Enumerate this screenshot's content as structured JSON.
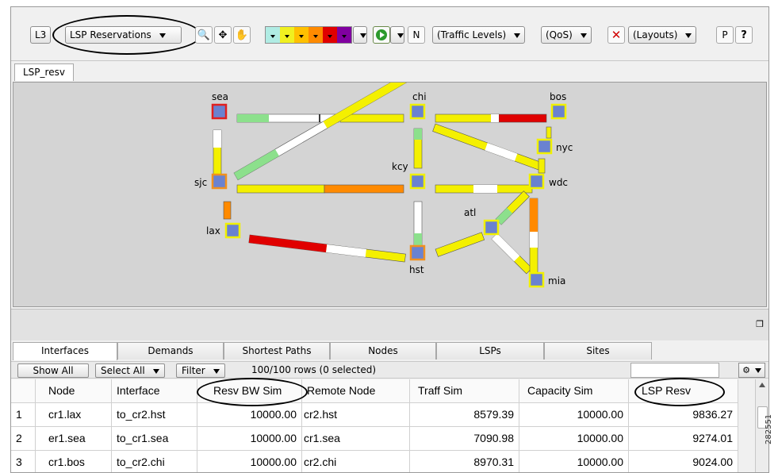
{
  "toolbar": {
    "layer_button": "L3",
    "view_dropdown": "LSP Reservations",
    "traffic_levels": "(Traffic Levels)",
    "qos": "(QoS)",
    "layouts": "(Layouts)",
    "sim_label": "N",
    "help_label": "?",
    "legend_colors": [
      "#b0ece4",
      "#f0f020",
      "#ffc000",
      "#ff8a00",
      "#e00000",
      "#8000a0"
    ]
  },
  "view_tab": "LSP_resv",
  "map": {
    "nodes": [
      {
        "id": "sea",
        "label": "sea"
      },
      {
        "id": "chi",
        "label": "chi"
      },
      {
        "id": "bos",
        "label": "bos"
      },
      {
        "id": "nyc",
        "label": "nyc"
      },
      {
        "id": "kcy",
        "label": "kcy"
      },
      {
        "id": "sjc",
        "label": "sjc"
      },
      {
        "id": "wdc",
        "label": "wdc"
      },
      {
        "id": "atl",
        "label": "atl"
      },
      {
        "id": "lax",
        "label": "lax"
      },
      {
        "id": "hst",
        "label": "hst"
      },
      {
        "id": "mia",
        "label": "mia"
      }
    ]
  },
  "grid_tabs": [
    "Interfaces",
    "Demands",
    "Shortest Paths",
    "Nodes",
    "LSPs",
    "Sites"
  ],
  "grid_toolbar": {
    "show_all": "Show All",
    "select_all": "Select All",
    "filter": "Filter",
    "row_count": "100/100 rows (0 selected)"
  },
  "table": {
    "columns": [
      "",
      "Node",
      "Interface",
      "Resv BW Sim",
      "Remote Node",
      "Traff Sim",
      "Capacity Sim",
      "LSP Resv"
    ],
    "rows": [
      [
        "1",
        "cr1.lax",
        "to_cr2.hst",
        "10000.00",
        "cr2.hst",
        "8579.39",
        "10000.00",
        "9836.27"
      ],
      [
        "2",
        "er1.sea",
        "to_cr1.sea",
        "10000.00",
        "cr1.sea",
        "7090.98",
        "10000.00",
        "9274.01"
      ],
      [
        "3",
        "cr1.bos",
        "to_cr2.chi",
        "10000.00",
        "cr2.chi",
        "8970.31",
        "10000.00",
        "9024.00"
      ]
    ]
  },
  "watermark": "282551"
}
